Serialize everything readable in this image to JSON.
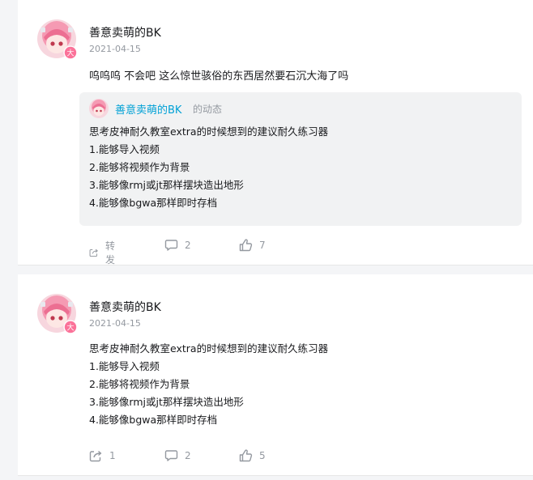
{
  "posts": [
    {
      "username": "善意卖萌的BK",
      "date": "2021-04-15",
      "text": "呜呜呜 不会吧 这么惊世骇俗的东西居然要石沉大海了吗",
      "repost": {
        "author": "善意卖萌的BK",
        "suffix": "的动态",
        "lines": [
          "思考皮神耐久教室extra的时候想到的建议耐久练习器",
          "1.能够导入视频",
          "2.能够将视频作为背景",
          "3.能够像rmj或jt那样摆块造出地形",
          "4.能够像bgwa那样即时存档"
        ]
      },
      "actions": {
        "forward": "转发",
        "comments": "2",
        "likes": "7"
      }
    },
    {
      "username": "善意卖萌的BK",
      "date": "2021-04-15",
      "lines": [
        "思考皮神耐久教室extra的时候想到的建议耐久练习器",
        "1.能够导入视频",
        "2.能够将视频作为背景",
        "3.能够像rmj或jt那样摆块造出地形",
        "4.能够像bgwa那样即时存档"
      ],
      "actions": {
        "forward": "1",
        "comments": "2",
        "likes": "5"
      }
    }
  ],
  "badge_char": "大",
  "colors": {
    "link": "#00a1d6",
    "muted": "#9499a0",
    "badge": "#fb7299"
  }
}
